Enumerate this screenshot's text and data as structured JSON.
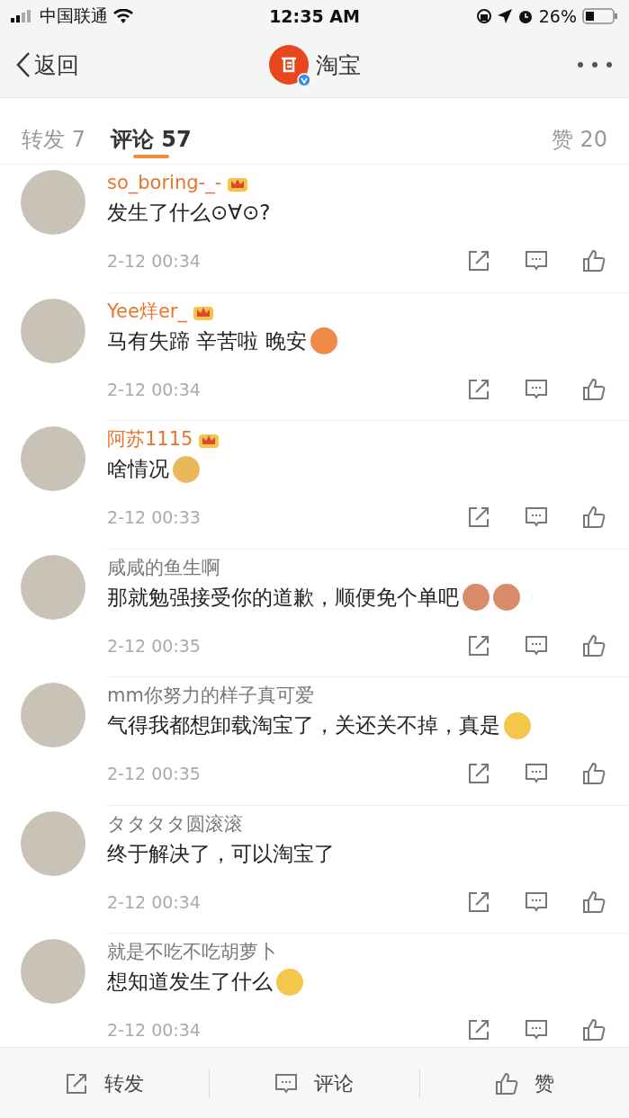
{
  "status_bar": {
    "carrier": "中国联通",
    "time": "12:35 AM",
    "battery": "26%"
  },
  "nav": {
    "back": "返回",
    "title": "淘宝",
    "verified": true
  },
  "tabs": [
    {
      "label": "转发 7",
      "selected": false
    },
    {
      "label": "评论 57",
      "selected": true
    },
    {
      "label": "赞 20",
      "selected": false
    }
  ],
  "comments": [
    {
      "user": "so_boring-_-",
      "vip": true,
      "text": "发生了什么⊙∀⊙?",
      "time": "2-12 00:34"
    },
    {
      "user": "Yee烊er_",
      "vip": true,
      "text": "马有失蹄 辛苦啦 晚安",
      "emojis": [
        {
          "kind": "hands"
        }
      ],
      "time": "2-12 00:34"
    },
    {
      "user": "阿苏1115",
      "vip": true,
      "text": "啥情况",
      "emojis": [
        {
          "kind": "dog"
        }
      ],
      "time": "2-12 00:33"
    },
    {
      "user": "咸咸的鱼生啊",
      "vip": false,
      "text": "那就勉强接受你的道歉，顺便免个单吧",
      "emojis": [
        {
          "kind": "pig"
        },
        {
          "kind": "pig"
        }
      ],
      "time": "2-12 00:35"
    },
    {
      "user": "mm你努力的样子真可爱",
      "vip": false,
      "text": "气得我都想卸载淘宝了，关还关不掉，真是",
      "emojis": [
        {
          "kind": "smile"
        }
      ],
      "time": "2-12 00:35"
    },
    {
      "user": "タタタタ圆滚滚",
      "vip": false,
      "text": "终于解决了，可以淘宝了",
      "time": "2-12 00:34"
    },
    {
      "user": "就是不吃不吃胡萝卜",
      "vip": false,
      "text": "想知道发生了什么",
      "emojis": [
        {
          "kind": "shush"
        }
      ],
      "time": "2-12 00:34"
    }
  ],
  "bottom_bar": [
    {
      "kind": "repost",
      "label": "转发"
    },
    {
      "kind": "comment",
      "label": "评论"
    },
    {
      "kind": "like",
      "label": "赞"
    }
  ]
}
